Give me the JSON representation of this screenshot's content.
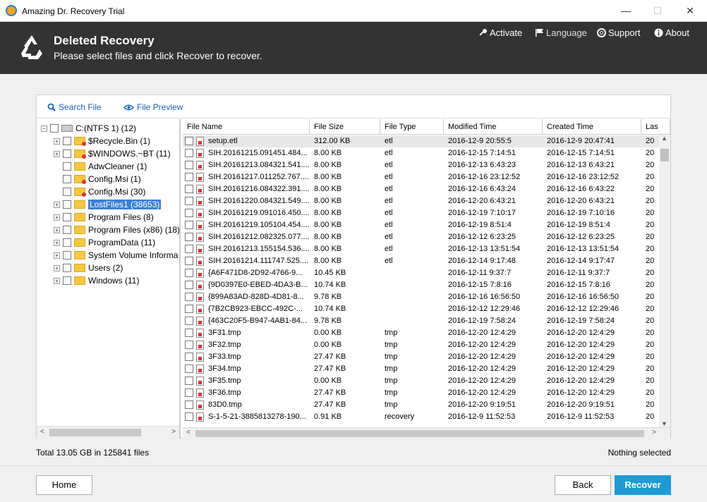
{
  "window": {
    "title": "Amazing Dr. Recovery Trial",
    "minimize": "—",
    "maximize": "☐",
    "close": "✕"
  },
  "header": {
    "title": "Deleted Recovery",
    "subtitle": "Please select files and click Recover to recover.",
    "nav": [
      {
        "label": "Activate",
        "icon": "key-icon"
      },
      {
        "label": "Language",
        "icon": "flag-icon"
      },
      {
        "label": "Support",
        "icon": "lifebuoy-icon"
      },
      {
        "label": "About",
        "icon": "info-icon"
      }
    ]
  },
  "tabs": [
    {
      "label": "Search File",
      "icon": "search-icon"
    },
    {
      "label": "File Preview",
      "icon": "eye-icon"
    }
  ],
  "tree": [
    {
      "label": "C:(NTFS 1) (12)",
      "level": 0,
      "expander": "−",
      "kind": "drive"
    },
    {
      "label": "$Recycle.Bin (1)",
      "level": 1,
      "expander": "+",
      "kind": "folder-red"
    },
    {
      "label": "$WINDOWS.~BT (11)",
      "level": 1,
      "expander": "+",
      "kind": "folder-red"
    },
    {
      "label": "AdwCleaner (1)",
      "level": 1,
      "expander": "",
      "kind": "folder"
    },
    {
      "label": "Config.Msi (1)",
      "level": 1,
      "expander": "",
      "kind": "folder-red"
    },
    {
      "label": "Config.Msi (30)",
      "level": 1,
      "expander": "",
      "kind": "folder-red"
    },
    {
      "label": "LostFiles1 (38653)",
      "level": 1,
      "expander": "+",
      "kind": "folder",
      "selected": true
    },
    {
      "label": "Program Files (8)",
      "level": 1,
      "expander": "+",
      "kind": "folder"
    },
    {
      "label": "Program Files (x86) (18)",
      "level": 1,
      "expander": "+",
      "kind": "folder"
    },
    {
      "label": "ProgramData (11)",
      "level": 1,
      "expander": "+",
      "kind": "folder"
    },
    {
      "label": "System Volume Informa",
      "level": 1,
      "expander": "+",
      "kind": "folder"
    },
    {
      "label": "Users (2)",
      "level": 1,
      "expander": "+",
      "kind": "folder"
    },
    {
      "label": "Windows (11)",
      "level": 1,
      "expander": "+",
      "kind": "folder"
    }
  ],
  "columns": [
    "File Name",
    "File Size",
    "File Type",
    "Modified Time",
    "Created Time",
    "Las"
  ],
  "rows": [
    [
      "setup.etl",
      "312.00 KB",
      "etl",
      "2016-12-9 20:55:5",
      "2016-12-9 20:47:41",
      "20"
    ],
    [
      "SIH.20161215.091451.484...",
      "8.00 KB",
      "etl",
      "2016-12-15 7:14:51",
      "2016-12-15 7:14:51",
      "20"
    ],
    [
      "SIH.20161213.084321.541....",
      "8.00 KB",
      "etl",
      "2016-12-13 6:43:23",
      "2016-12-13 6:43:21",
      "20"
    ],
    [
      "SIH.20161217.011252.767....",
      "8.00 KB",
      "etl",
      "2016-12-16 23:12:52",
      "2016-12-16 23:12:52",
      "20"
    ],
    [
      "SIH.20161216.084322.391....",
      "8.00 KB",
      "etl",
      "2016-12-16 6:43:24",
      "2016-12-16 6:43:22",
      "20"
    ],
    [
      "SIH.20161220.084321.549....",
      "8.00 KB",
      "etl",
      "2016-12-20 6:43:21",
      "2016-12-20 6:43:21",
      "20"
    ],
    [
      "SIH.20161219.091016.450....",
      "8.00 KB",
      "etl",
      "2016-12-19 7:10:17",
      "2016-12-19 7:10:16",
      "20"
    ],
    [
      "SIH.20161219.105104.454....",
      "8.00 KB",
      "etl",
      "2016-12-19 8:51:4",
      "2016-12-19 8:51:4",
      "20"
    ],
    [
      "SIH.20161212.082325.077....",
      "8.00 KB",
      "etl",
      "2016-12-12 6:23:25",
      "2016-12-12 6:23:25",
      "20"
    ],
    [
      "SIH.20161213.155154.536....",
      "8.00 KB",
      "etl",
      "2016-12-13 13:51:54",
      "2016-12-13 13:51:54",
      "20"
    ],
    [
      "SIH.20161214.111747.525....",
      "8.00 KB",
      "etl",
      "2016-12-14 9:17:48",
      "2016-12-14 9:17:47",
      "20"
    ],
    [
      "{A6F471D8-2D92-4766-9...",
      "10.45 KB",
      "",
      "2016-12-11 9:37:7",
      "2016-12-11 9:37:7",
      "20"
    ],
    [
      "{9D0397E0-EBED-4DA3-B...",
      "10.74 KB",
      "",
      "2016-12-15 7:8:16",
      "2016-12-15 7:8:16",
      "20"
    ],
    [
      "{899A83AD-828D-4D81-8...",
      "9.78 KB",
      "",
      "2016-12-16 16:56:50",
      "2016-12-16 16:56:50",
      "20"
    ],
    [
      "{7B2CB923-EBCC-492C-...",
      "10.74 KB",
      "",
      "2016-12-12 12:29:46",
      "2016-12-12 12:29:46",
      "20"
    ],
    [
      "{463C20F5-B947-4AB1-84...",
      "9.78 KB",
      "",
      "2016-12-19 7:58:24",
      "2016-12-19 7:58:24",
      "20"
    ],
    [
      "3F31.tmp",
      "0.00 KB",
      "tmp",
      "2016-12-20 12:4:29",
      "2016-12-20 12:4:29",
      "20"
    ],
    [
      "3F32.tmp",
      "0.00 KB",
      "tmp",
      "2016-12-20 12:4:29",
      "2016-12-20 12:4:29",
      "20"
    ],
    [
      "3F33.tmp",
      "27.47 KB",
      "tmp",
      "2016-12-20 12:4:29",
      "2016-12-20 12:4:29",
      "20"
    ],
    [
      "3F34.tmp",
      "27.47 KB",
      "tmp",
      "2016-12-20 12:4:29",
      "2016-12-20 12:4:29",
      "20"
    ],
    [
      "3F35.tmp",
      "0.00 KB",
      "tmp",
      "2016-12-20 12:4:29",
      "2016-12-20 12:4:29",
      "20"
    ],
    [
      "3F36.tmp",
      "27.47 KB",
      "tmp",
      "2016-12-20 12:4:29",
      "2016-12-20 12:4:29",
      "20"
    ],
    [
      "83D0.tmp",
      "27.47 KB",
      "tmp",
      "2016-12-20 9:19:51",
      "2016-12-20 9:19:51",
      "20"
    ],
    [
      "S-1-5-21-3885813278-190...",
      "0.91 KB",
      "recovery",
      "2016-12-9 11:52:53",
      "2016-12-9 11:52:53",
      "20"
    ]
  ],
  "status": {
    "total": "Total 13.05 GB in 125841 files",
    "selection": "Nothing selected"
  },
  "buttons": {
    "home": "Home",
    "back": "Back",
    "recover": "Recover"
  },
  "colors": {
    "header_bg": "#333333",
    "accent": "#1e9bd7",
    "link": "#1a62b8",
    "selection": "#3a7fd5"
  }
}
